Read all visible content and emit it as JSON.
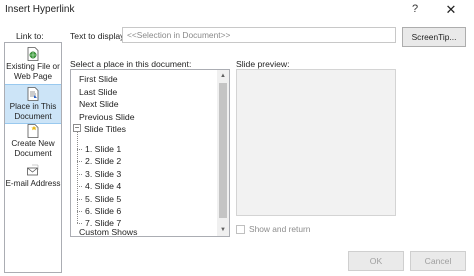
{
  "dialog": {
    "title": "Insert Hyperlink",
    "help": "?",
    "close": "✕"
  },
  "link_to": {
    "label": "Link to:",
    "items": [
      {
        "label": "Existing File or Web Page",
        "icon": "globe-file-icon",
        "selected": false
      },
      {
        "label": "Place in This Document",
        "icon": "document-place-icon",
        "selected": true
      },
      {
        "label": "Create New Document",
        "icon": "new-document-icon",
        "selected": false
      },
      {
        "label": "E-mail Address",
        "icon": "email-icon",
        "selected": false
      }
    ]
  },
  "text_to_display": {
    "label": "Text to display:",
    "value": "<<Selection in Document>>"
  },
  "screentip": {
    "label": "ScreenTip..."
  },
  "place": {
    "label": "Select a place in this document:",
    "items": [
      {
        "label": "First Slide"
      },
      {
        "label": "Last Slide"
      },
      {
        "label": "Next Slide"
      },
      {
        "label": "Previous Slide"
      },
      {
        "label": "Slide Titles",
        "expander": "−"
      },
      {
        "label": "1. Slide 1"
      },
      {
        "label": "2. Slide 2"
      },
      {
        "label": "3. Slide 3"
      },
      {
        "label": "4. Slide 4"
      },
      {
        "label": "5. Slide 5"
      },
      {
        "label": "6. Slide 6"
      },
      {
        "label": "7. Slide 7"
      },
      {
        "label": "Custom Shows"
      }
    ]
  },
  "preview": {
    "label": "Slide preview:"
  },
  "show_return": {
    "label": "Show and return",
    "checked": false
  },
  "buttons": {
    "ok": "OK",
    "cancel": "Cancel"
  },
  "colors": {
    "selection": "#cce4f7",
    "disabled_text": "#a0a0a0"
  }
}
